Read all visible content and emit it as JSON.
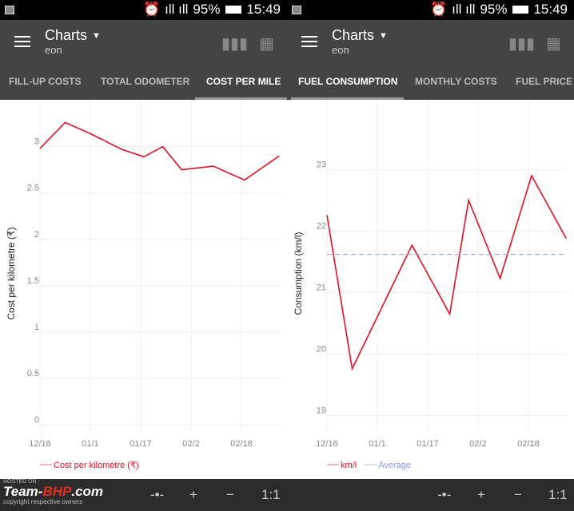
{
  "status_bar": {
    "battery": "95%",
    "time": "15:49"
  },
  "app_bar": {
    "title": "Charts",
    "subtitle": "eon"
  },
  "left": {
    "tabs": [
      {
        "label": "FILL-UP COSTS",
        "selected": false
      },
      {
        "label": "TOTAL ODOMETER",
        "selected": false
      },
      {
        "label": "COST PER MILE",
        "selected": true
      }
    ]
  },
  "right": {
    "tabs": [
      {
        "label": "FUEL CONSUMPTION",
        "selected": true
      },
      {
        "label": "MONTHLY COSTS",
        "selected": false
      },
      {
        "label": "FUEL PRICE",
        "selected": false
      }
    ]
  },
  "bottom": {
    "fit_icon": "-•-",
    "zoom_in": "+",
    "zoom_out": "−",
    "reset": "1:1"
  },
  "watermark": {
    "hosted": "HOSTED ON :",
    "brand": "Team-BHP.com",
    "copyright": "copyright respective owners"
  },
  "chart_data": [
    {
      "type": "line",
      "ylabel": "Cost per kilometre (₹)",
      "ylim": [
        0,
        3.35
      ],
      "yticks": [
        "0",
        "0.5",
        "1",
        "1.5",
        "2",
        "2.5",
        "3"
      ],
      "xticks": [
        "12/16",
        "01/1",
        "01/17",
        "02/2",
        "02/18"
      ],
      "grid": true,
      "legend": "bottom-left",
      "series": [
        {
          "name": "Cost per kilometre (₹)",
          "color": "#e01020",
          "x": [
            "12/16",
            "12/24",
            "01/01",
            "01/11",
            "01/18",
            "01/24",
            "01/30",
            "02/09",
            "02/19",
            "03/02"
          ],
          "y": [
            2.98,
            3.26,
            3.14,
            2.97,
            2.89,
            3.0,
            2.75,
            2.79,
            2.64,
            2.9
          ]
        }
      ]
    },
    {
      "type": "line",
      "ylabel": "Consumption (km/l)",
      "ylim": [
        18.85,
        23.9
      ],
      "yticks": [
        "19",
        "20",
        "21",
        "22",
        "23"
      ],
      "xticks": [
        "12/16",
        "01/1",
        "01/17",
        "02/2",
        "02/18"
      ],
      "grid": true,
      "legend": "bottom-left",
      "series": [
        {
          "name": "km/l",
          "color": "#e01020",
          "x": [
            "12/16",
            "12/24",
            "01/12",
            "01/24",
            "01/30",
            "02/09",
            "02/19",
            "03/02"
          ],
          "y": [
            22.26,
            19.76,
            21.77,
            20.65,
            22.5,
            21.23,
            22.9,
            21.88
          ]
        },
        {
          "name": "Average",
          "color": "#8a9ae0",
          "dashed": true,
          "value": 21.62
        }
      ]
    }
  ]
}
